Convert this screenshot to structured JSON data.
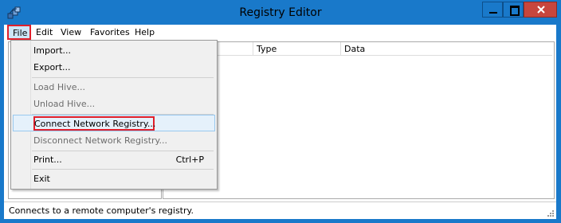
{
  "window": {
    "title": "Registry Editor",
    "accent": "#1979ca",
    "highlight_color": "#e0202c"
  },
  "menubar": {
    "items": [
      "File",
      "Edit",
      "View",
      "Favorites",
      "Help"
    ]
  },
  "list_columns": [
    "Type",
    "Data"
  ],
  "file_menu": {
    "items": [
      {
        "label": "Import...",
        "enabled": true
      },
      {
        "label": "Export...",
        "enabled": true
      },
      {
        "label": "Load Hive...",
        "enabled": false
      },
      {
        "label": "Unload Hive...",
        "enabled": false
      },
      {
        "label": "Connect Network Registry...",
        "enabled": true,
        "highlighted": true
      },
      {
        "label": "Disconnect Network Registry...",
        "enabled": false
      },
      {
        "label": "Print...",
        "enabled": true,
        "shortcut": "Ctrl+P"
      },
      {
        "label": "Exit",
        "enabled": true
      }
    ]
  },
  "status": {
    "text": "Connects to a remote computer's registry."
  }
}
